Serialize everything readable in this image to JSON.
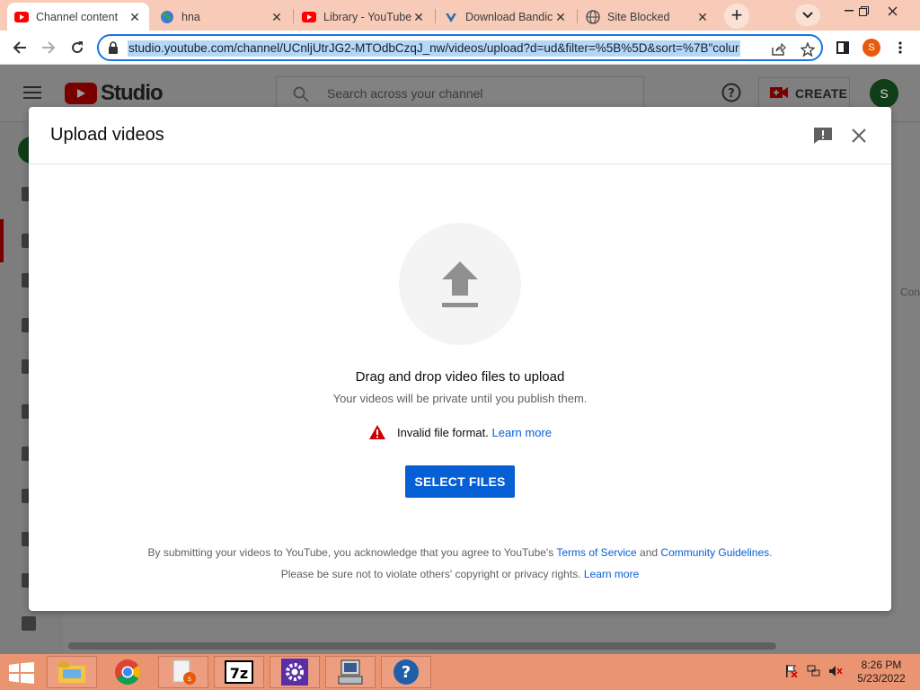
{
  "browser": {
    "tabs": [
      {
        "title": "Channel content",
        "favicon": "youtube-icon",
        "active": true
      },
      {
        "title": "hna",
        "favicon": "globe-icon",
        "active": false
      },
      {
        "title": "Library - YouTube",
        "favicon": "youtube-icon",
        "active": false
      },
      {
        "title": "Download Bandic",
        "favicon": "bandicam-icon",
        "active": false
      },
      {
        "title": "Site Blocked",
        "favicon": "globe-icon",
        "active": false
      }
    ],
    "url": "studio.youtube.com/channel/UCnljUtrJG2-MTOdbCzqJ_nw/videos/upload?d=ud&filter=%5B%5D&sort=%7B\"colur",
    "profile_initial": "S"
  },
  "studio": {
    "logo_text": "Studio",
    "search_placeholder": "Search across your channel",
    "create_label": "CREATE",
    "avatar_initial": "S",
    "bg_partial_text": "Con"
  },
  "dialog": {
    "title": "Upload videos",
    "drag_text": "Drag and drop video files to upload",
    "private_text": "Your videos will be private until you publish them.",
    "error_text": "Invalid file format.",
    "error_link": "Learn more",
    "select_button": "SELECT FILES",
    "terms_prefix": "By submitting your videos to YouTube, you acknowledge that you agree to YouTube's",
    "terms_link": "Terms of Service",
    "terms_and": "and",
    "guidelines_link": "Community Guidelines",
    "terms_suffix": ".",
    "privacy_text": "Please be sure not to violate others' copyright or privacy rights.",
    "privacy_link": "Learn more"
  },
  "taskbar": {
    "apps": [
      "file-explorer-icon",
      "chrome-icon",
      "chrome-profile-icon",
      "7zip-icon",
      "settings-app-icon",
      "computer-icon",
      "help-icon"
    ],
    "time": "8:26 PM",
    "date": "5/23/2022"
  },
  "colors": {
    "accent_blue": "#065fd4",
    "tabstrip": "#f7cbb7",
    "taskbar": "#ea9472",
    "error_red": "#cc0000"
  }
}
